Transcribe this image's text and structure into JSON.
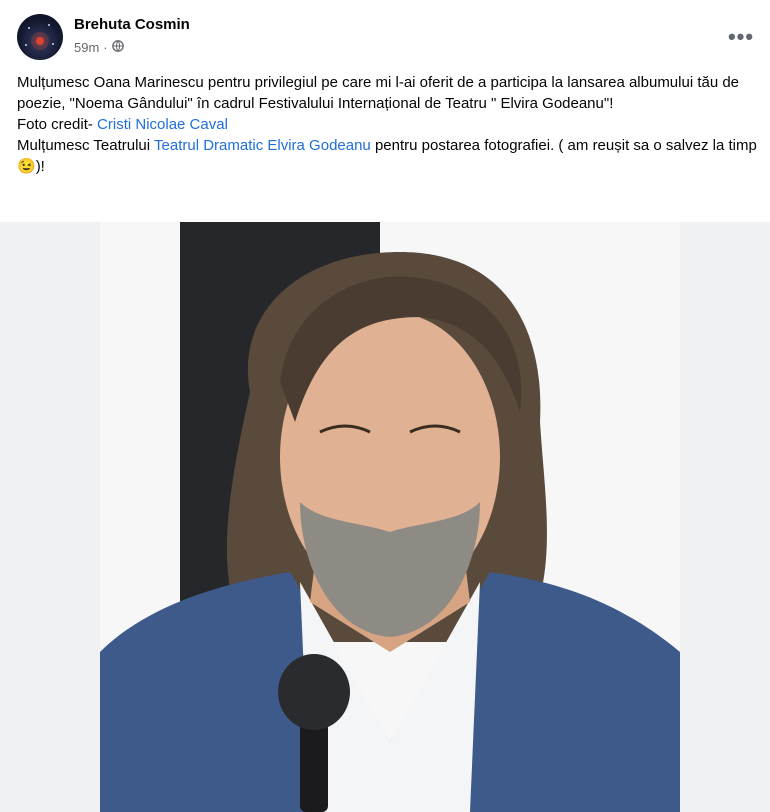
{
  "post": {
    "author": "Brehuta Cosmin",
    "time": "59m",
    "audience_icon": "globe-icon",
    "menu_icon": "more-horizontal-icon",
    "text": {
      "line1_a": "Mulțumesc Oana Marinescu pentru privilegiul pe care mi l-ai oferit de a participa la lansarea albumului tău de poezie, \"Noema Gândului\" în cadrul Festivalului Internațional de Teatru \" Elvira Godeanu\"!",
      "credit_prefix": "Foto credit- ",
      "credit_link": "Cristi Nicolae Caval",
      "thanks_prefix": "Mulțumesc Teatrului ",
      "thanks_link": "Teatrul Dramatic Elvira Godeanu",
      "thanks_suffix": " pentru postarea fotografiei. ( am reușit sa o salvez la timp",
      "emoji": "😉",
      "thanks_end": ")!"
    },
    "photo_alt": "photo"
  },
  "colors": {
    "link": "#216fdb",
    "meta": "#65676b",
    "jacket": "#3d5a8a",
    "background": "#f0f1f3"
  }
}
